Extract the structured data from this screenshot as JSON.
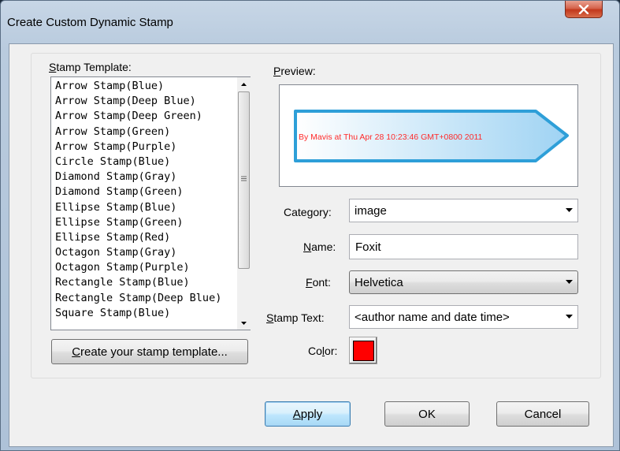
{
  "window": {
    "title": "Create Custom Dynamic Stamp",
    "close_glyph": "x"
  },
  "template": {
    "label_accel": "S",
    "label_rest": "tamp Template:",
    "items": [
      "Arrow Stamp(Blue)",
      "Arrow Stamp(Deep Blue)",
      "Arrow Stamp(Deep Green)",
      "Arrow Stamp(Green)",
      "Arrow Stamp(Purple)",
      "Circle Stamp(Blue)",
      "Diamond Stamp(Gray)",
      "Diamond Stamp(Green)",
      "Ellipse Stamp(Blue)",
      "Ellipse Stamp(Green)",
      "Ellipse Stamp(Red)",
      "Octagon Stamp(Gray)",
      "Octagon Stamp(Purple)",
      "Rectangle Stamp(Blue)",
      "Rectangle Stamp(Deep Blue)",
      "Square Stamp(Blue)"
    ],
    "create_accel": "C",
    "create_rest": "reate your stamp template..."
  },
  "preview": {
    "label_accel": "P",
    "label_rest": "review:",
    "stamp_text": "By Mavis at Thu Apr 28 10:23:46 GMT+0800 2011",
    "stamp_text_color": "#ff2a2a",
    "stamp_fill": "#9fd3f3",
    "stamp_border": "#2e9fd8"
  },
  "form": {
    "category_pre": "Cate",
    "category_accel": "g",
    "category_post": "ory:",
    "category_value": "image",
    "name_accel": "N",
    "name_rest": "ame:",
    "name_value": "Foxit",
    "font_accel": "F",
    "font_rest": "ont:",
    "font_value": "Helvetica",
    "stamp_text_accel": "S",
    "stamp_text_rest": "tamp Text:",
    "stamp_text_value": "<author name and date time>",
    "color_pre": "Co",
    "color_accel": "l",
    "color_post": "or:",
    "color_value": "#ff0000"
  },
  "buttons": {
    "apply_accel": "A",
    "apply_rest": "pply",
    "ok": "OK",
    "cancel": "Cancel"
  },
  "icons": {
    "scroll_up": "chevron-up-icon",
    "scroll_down": "chevron-down-icon",
    "grip": "scroll-grip-icon",
    "dropdown": "dropdown-arrow-icon",
    "close": "close-icon"
  }
}
